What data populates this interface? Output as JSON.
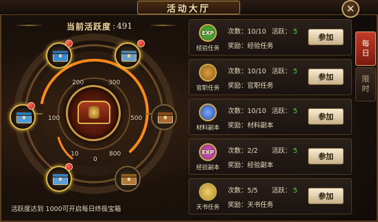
{
  "window": {
    "title": "活动大厅",
    "close_glyph": "✕"
  },
  "activity": {
    "label": "当前活跃度",
    "separator": ":",
    "value": "491"
  },
  "wheel": {
    "ticks": [
      "200",
      "300",
      "100",
      "500",
      "10",
      "0",
      "800"
    ],
    "chests": [
      {
        "name": "chest-1",
        "lit": true,
        "badge": true,
        "color": "#3a8ad0"
      },
      {
        "name": "chest-2",
        "lit": true,
        "badge": true,
        "color": "#6aa0c8"
      },
      {
        "name": "chest-3",
        "lit": true,
        "badge": true,
        "color": "#4a9ad8"
      },
      {
        "name": "chest-4",
        "lit": false,
        "badge": false,
        "color": "#a86a30"
      },
      {
        "name": "chest-5",
        "lit": true,
        "badge": true,
        "color": "#5aa0d8"
      },
      {
        "name": "chest-6",
        "lit": false,
        "badge": false,
        "color": "#b07a3a"
      }
    ],
    "hint": "活跃度达到 1000可开启每日终极宝箱"
  },
  "tasks": [
    {
      "icon_text": "EXP",
      "icon_name": "exp-scroll-icon",
      "icon_color": "#2f7a2a",
      "label": "经验任务",
      "count_label": "次数：",
      "count": "10/10",
      "active_label": "活跃：",
      "active": "5",
      "reward_label": "奖励：",
      "reward": "经验任务",
      "button": "参加"
    },
    {
      "icon_text": "",
      "icon_name": "official-seal-icon",
      "icon_color": "#8a5a1a",
      "label": "官职任务",
      "count_label": "次数：",
      "count": "10/10",
      "active_label": "活跃：",
      "active": "5",
      "reward_label": "奖励：",
      "reward": "官职任务",
      "button": "参加"
    },
    {
      "icon_text": "",
      "icon_name": "material-orb-icon",
      "icon_color": "#2a4a9a",
      "label": "材料副本",
      "count_label": "次数：",
      "count": "10/10",
      "active_label": "活跃：",
      "active": "5",
      "reward_label": "奖励：",
      "reward": "材料副本",
      "button": "参加"
    },
    {
      "icon_text": "EXP",
      "icon_name": "exp-crystal-icon",
      "icon_color": "#8a2a7a",
      "label": "经验副本",
      "count_label": "次数：",
      "count": "2/2",
      "active_label": "活跃：",
      "active": "5",
      "reward_label": "奖励：",
      "reward": "经验副本",
      "button": "参加"
    },
    {
      "icon_text": "",
      "icon_name": "heaven-book-icon",
      "icon_color": "#b08a2a",
      "label": "天书任务",
      "count_label": "次数：",
      "count": "5/5",
      "active_label": "活跃：",
      "active": "5",
      "reward_label": "奖励：",
      "reward": "天书任务",
      "button": "参加"
    }
  ],
  "tabs": [
    {
      "chars": [
        "每",
        "日"
      ],
      "active": true
    },
    {
      "chars": [
        "限",
        "时"
      ],
      "active": false
    }
  ]
}
